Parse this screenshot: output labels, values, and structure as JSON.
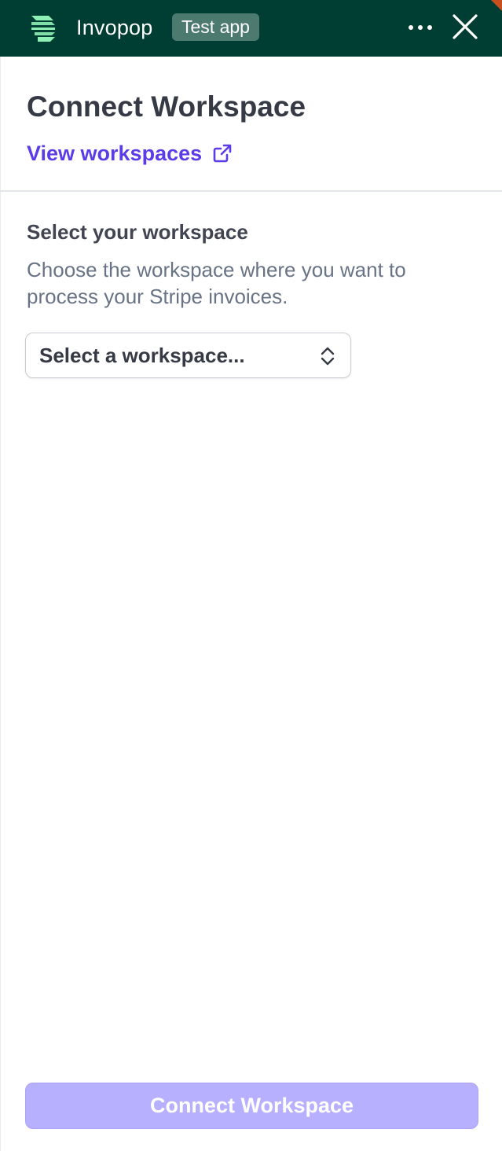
{
  "header": {
    "app_name": "Invopop",
    "badge": "Test app",
    "icons": {
      "logo": "invopop-logo-icon",
      "more": "ellipsis-icon",
      "close": "close-icon"
    },
    "colors": {
      "background": "#003d33",
      "badge": "#4d7a6f",
      "logo": "#8ef0b4"
    }
  },
  "page": {
    "title": "Connect Workspace",
    "view_link": {
      "label": "View workspaces",
      "icon": "external-link-icon",
      "color": "#5b3de8"
    }
  },
  "section": {
    "title": "Select your workspace",
    "description": "Choose the workspace where you want to process your Stripe invoices."
  },
  "workspace_select": {
    "value": "Select a workspace...",
    "icon": "chevron-up-down-icon"
  },
  "footer": {
    "connect_button": {
      "label": "Connect Workspace",
      "state": "disabled",
      "color": "#b7b0ff"
    }
  }
}
